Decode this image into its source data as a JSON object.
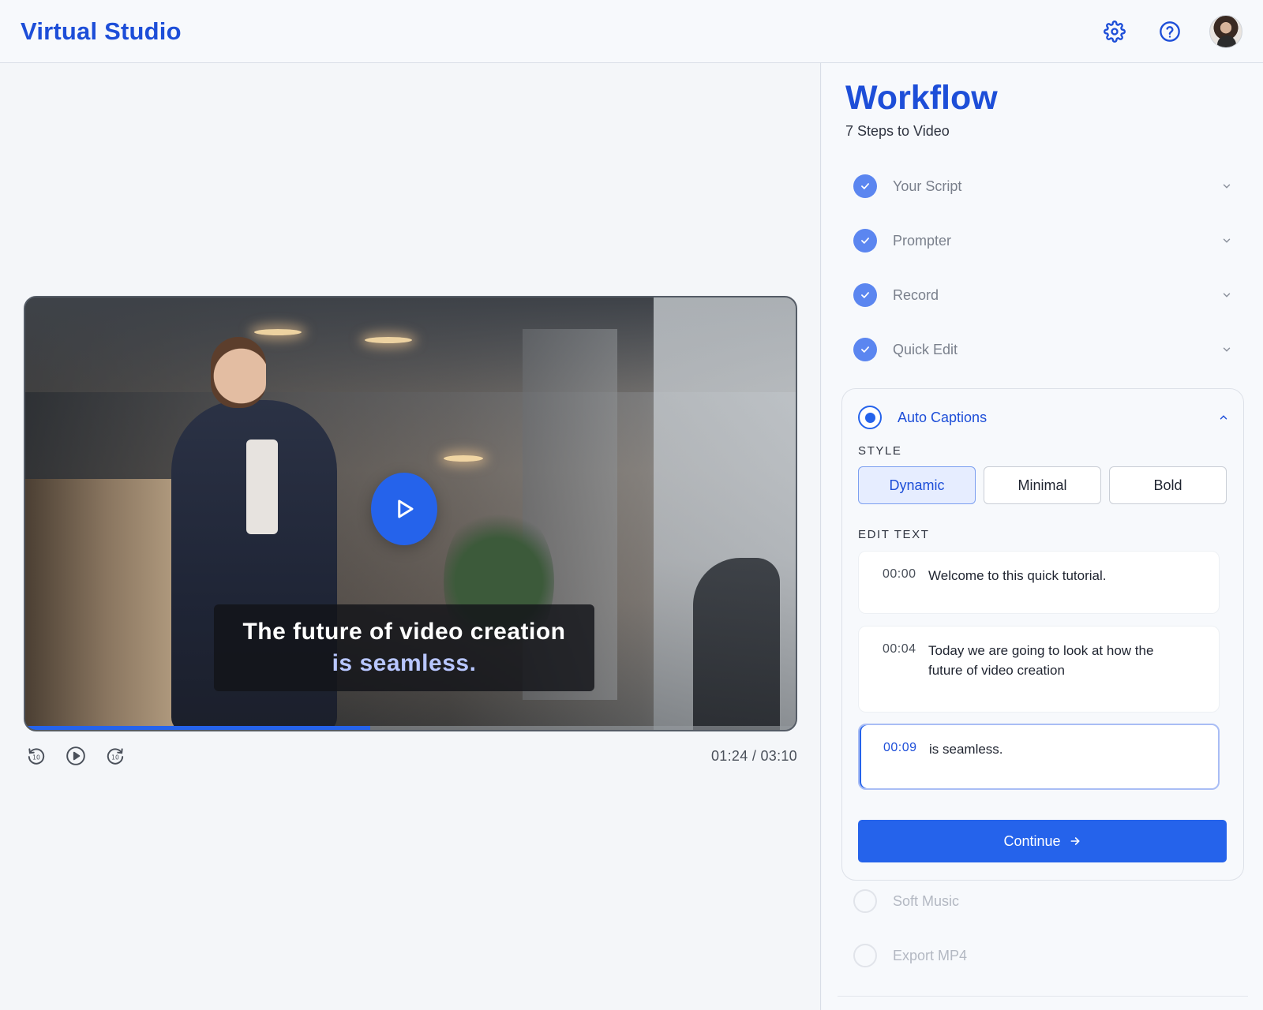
{
  "app": {
    "title": "Virtual Studio"
  },
  "header": {
    "icons": [
      "gear-icon",
      "help-icon",
      "user-avatar"
    ]
  },
  "player": {
    "caption_line1": "The future of video creation",
    "caption_line2": "is seamless.",
    "progress_fraction": 0.448,
    "current_time": "01:24",
    "total_time": "03:10",
    "timecode": "01:24 / 03:10",
    "controls": [
      "rewind-10-icon",
      "play-icon",
      "forward-10-icon"
    ]
  },
  "workflow": {
    "title": "Workflow",
    "subtitle": "7 Steps to Video",
    "steps": [
      {
        "label": "Your Script",
        "status": "done"
      },
      {
        "label": "Prompter",
        "status": "done"
      },
      {
        "label": "Record",
        "status": "done"
      },
      {
        "label": "Quick Edit",
        "status": "done"
      },
      {
        "label": "Auto Captions",
        "status": "active"
      },
      {
        "label": "Soft Music",
        "status": "pending"
      },
      {
        "label": "Export MP4",
        "status": "pending"
      }
    ],
    "captions_panel": {
      "style_label": "STYLE",
      "styles": [
        "Dynamic",
        "Minimal",
        "Bold"
      ],
      "selected_style": "Dynamic",
      "edit_label": "EDIT TEXT",
      "rows": [
        {
          "time": "00:00",
          "text": "Welcome to this quick tutorial."
        },
        {
          "time": "00:04",
          "text": "Today we are going to look at how the future of video creation"
        },
        {
          "time": "00:09",
          "text": "is seamless."
        }
      ],
      "continue_label": "Continue"
    }
  },
  "colors": {
    "accent": "#2563eb",
    "brand": "#1d4ed8",
    "done_check": "#5b86f0"
  }
}
